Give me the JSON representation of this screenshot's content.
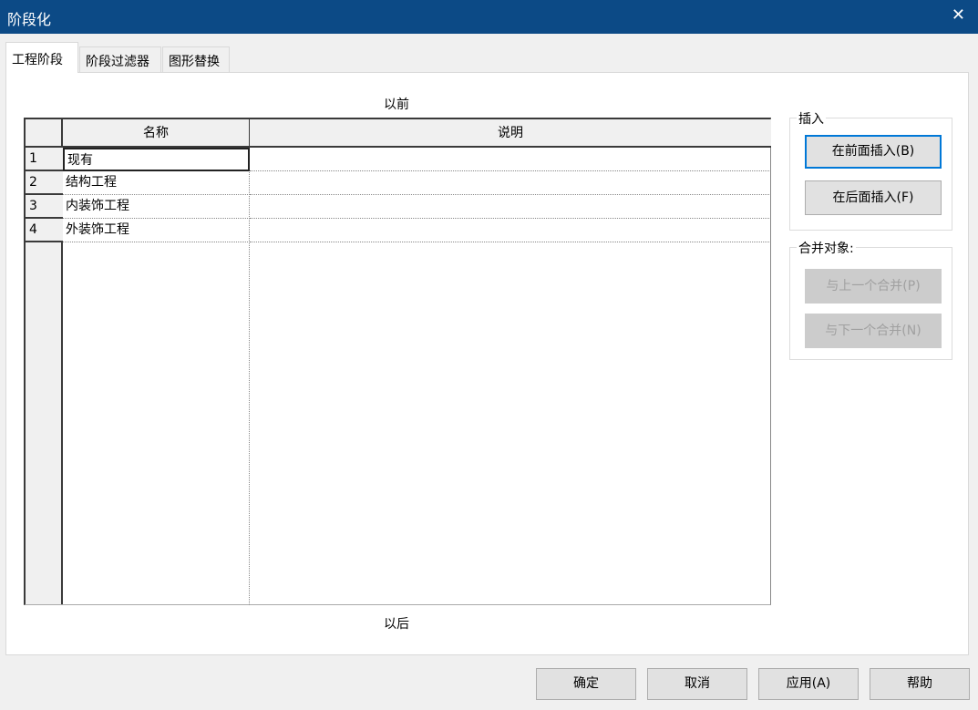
{
  "window": {
    "title": "阶段化",
    "close": "✕"
  },
  "tabs": [
    {
      "label": "工程阶段"
    },
    {
      "label": "阶段过滤器"
    },
    {
      "label": "图形替换"
    }
  ],
  "main": {
    "before_label": "以前",
    "after_label": "以后",
    "columns": {
      "name": "名称",
      "description": "说明"
    },
    "rows": [
      {
        "num": "1",
        "name": "现有",
        "description": ""
      },
      {
        "num": "2",
        "name": "结构工程",
        "description": ""
      },
      {
        "num": "3",
        "name": "内装饰工程",
        "description": ""
      },
      {
        "num": "4",
        "name": "外装饰工程",
        "description": ""
      }
    ]
  },
  "insert_group": {
    "label": "插入",
    "before": "在前面插入(B)",
    "after": "在后面插入(F)"
  },
  "merge_group": {
    "label": "合并对象:",
    "prev": "与上一个合并(P)",
    "next": "与下一个合并(N)"
  },
  "footer": {
    "ok": "确定",
    "cancel": "取消",
    "apply": "应用(A)",
    "help": "帮助"
  }
}
